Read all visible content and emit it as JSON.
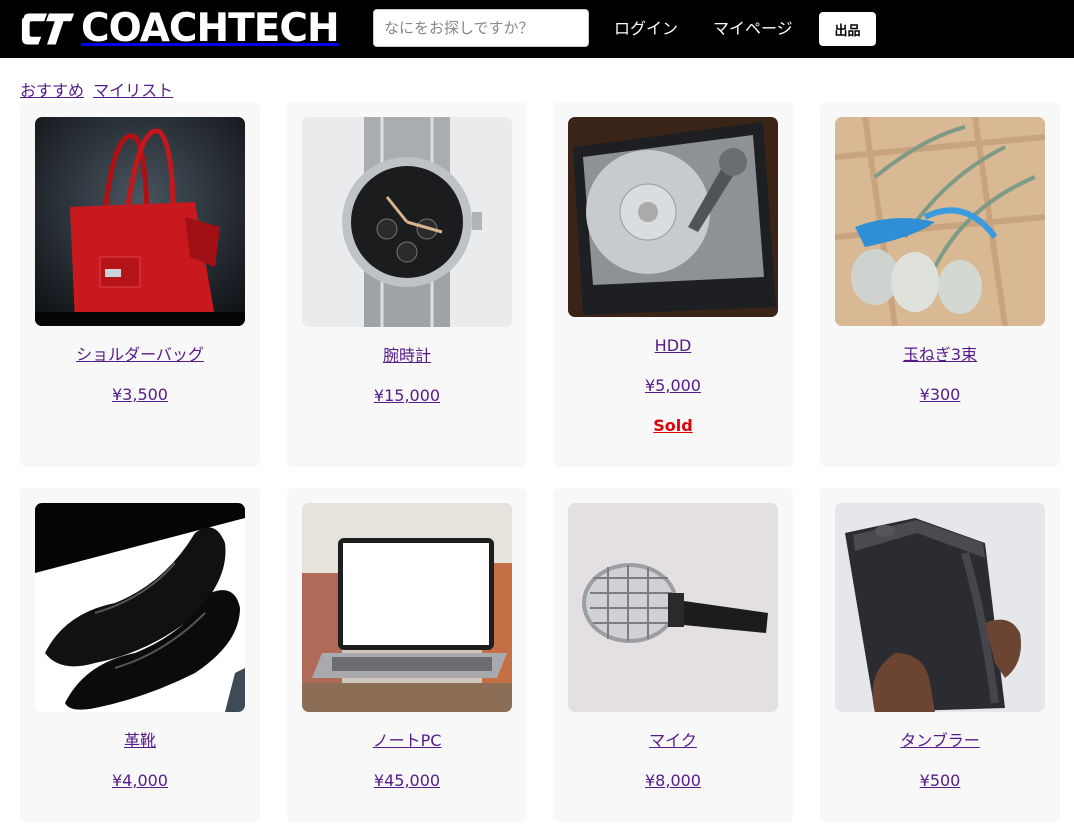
{
  "header": {
    "logo_text": "COACHTECH",
    "search_placeholder": "なにをお探しですか？",
    "login_label": "ログイン",
    "mypage_label": "マイページ",
    "sell_label": "出品"
  },
  "tabs": [
    {
      "label": "おすすめ"
    },
    {
      "label": "マイリスト"
    }
  ],
  "products": [
    {
      "name": "ショルダーバッグ",
      "price": "¥3,500",
      "sold": "",
      "image": "red-handbag"
    },
    {
      "name": "腕時計",
      "price": "¥15,000",
      "sold": "",
      "image": "wrist-watch"
    },
    {
      "name": "HDD",
      "price": "¥5,000",
      "sold": "Sold",
      "image": "hard-disk-drive"
    },
    {
      "name": "玉ねぎ3束",
      "price": "¥300",
      "sold": "",
      "image": "onion-bundle"
    },
    {
      "name": "革靴",
      "price": "¥4,000",
      "sold": "",
      "image": "leather-shoes"
    },
    {
      "name": "ノートPC",
      "price": "¥45,000",
      "sold": "",
      "image": "laptop"
    },
    {
      "name": "マイク",
      "price": "¥8,000",
      "sold": "",
      "image": "microphone"
    },
    {
      "name": "タンブラー",
      "price": "¥500",
      "sold": "",
      "image": "tumbler"
    }
  ]
}
